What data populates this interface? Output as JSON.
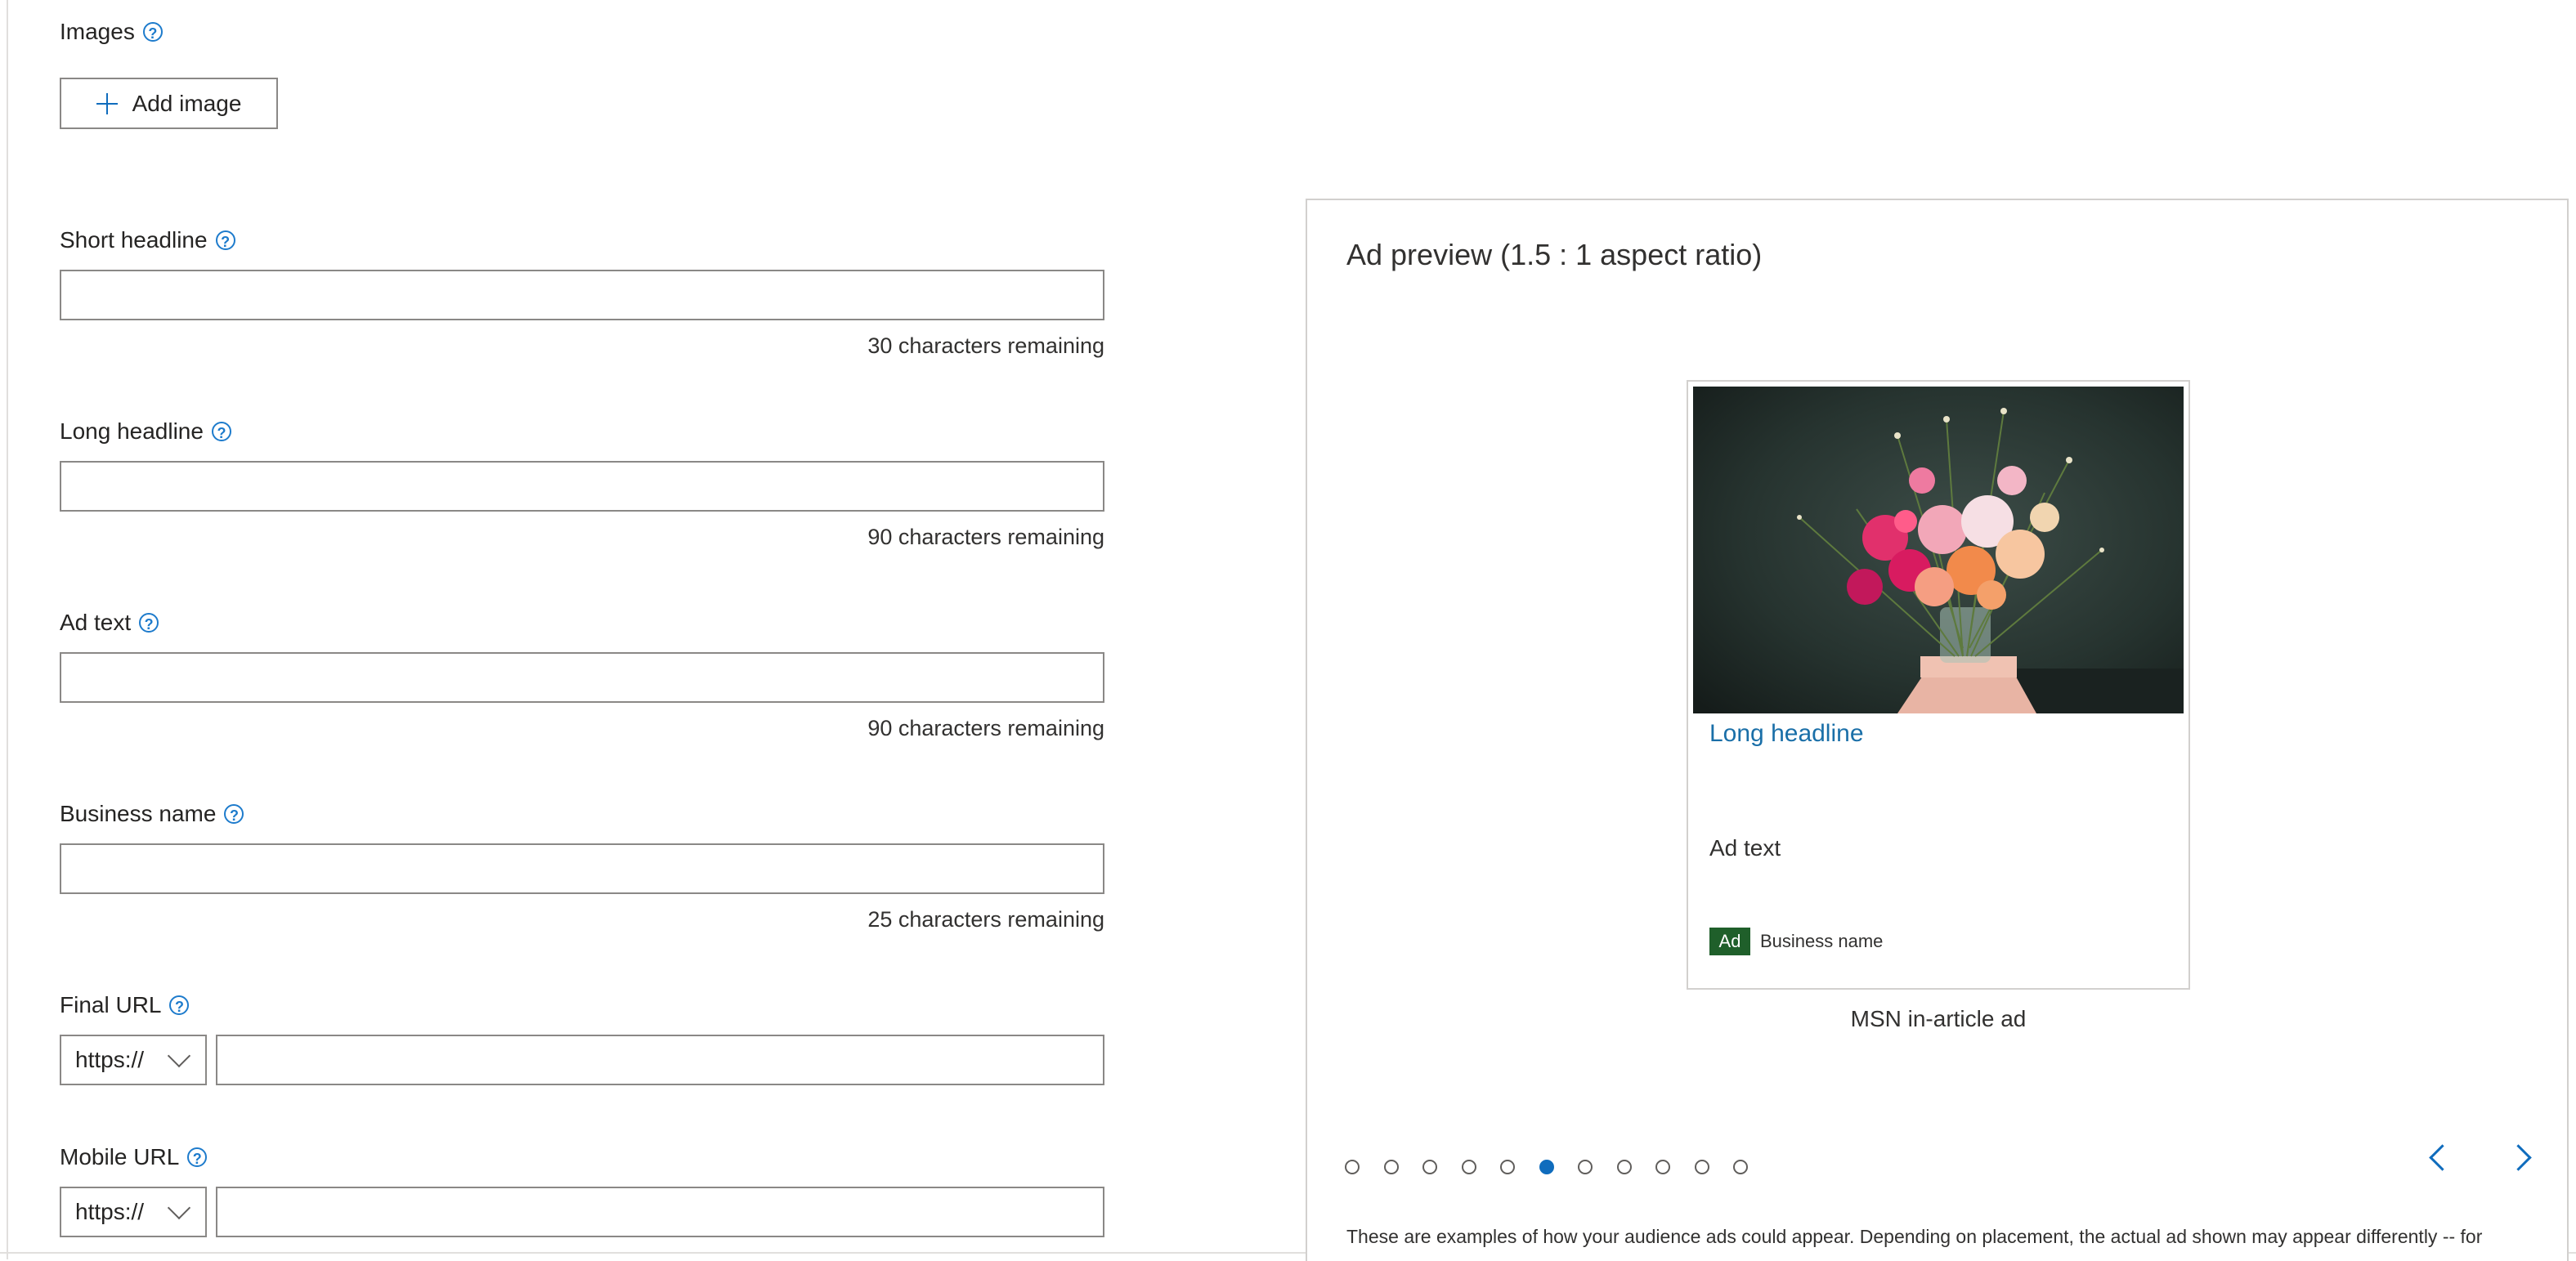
{
  "images": {
    "label": "Images",
    "add_button": "Add image"
  },
  "fields": {
    "short_headline": {
      "label": "Short headline",
      "value": "",
      "remaining": "30 characters remaining"
    },
    "long_headline": {
      "label": "Long headline",
      "value": "",
      "remaining": "90 characters remaining"
    },
    "ad_text": {
      "label": "Ad text",
      "value": "",
      "remaining": "90 characters remaining"
    },
    "business_name": {
      "label": "Business name",
      "value": "",
      "remaining": "25 characters remaining"
    },
    "final_url": {
      "label": "Final URL",
      "protocol": "https://",
      "value": ""
    },
    "mobile_url": {
      "label": "Mobile URL",
      "protocol": "https://",
      "value": ""
    }
  },
  "help_glyph": "?",
  "preview": {
    "title": "Ad preview (1.5 : 1 aspect ratio)",
    "card": {
      "headline": "Long headline",
      "ad_text": "Ad text",
      "badge": "Ad",
      "business_name": "Business name"
    },
    "caption": "MSN in-article ad",
    "carousel": {
      "total": 11,
      "active_index": 5
    },
    "disclaimer": "These are examples of how your audience ads could appear. Depending on placement, the actual ad shown may appear differently -- for"
  },
  "icons": {
    "help": "help-circle-icon",
    "add": "plus-icon",
    "dropdown": "chevron-down-icon",
    "prev": "chevron-left-icon",
    "next": "chevron-right-icon"
  },
  "colors": {
    "accent": "#0f6cbd",
    "link": "#1a6fa8",
    "ad_badge": "#1f5f2a"
  }
}
